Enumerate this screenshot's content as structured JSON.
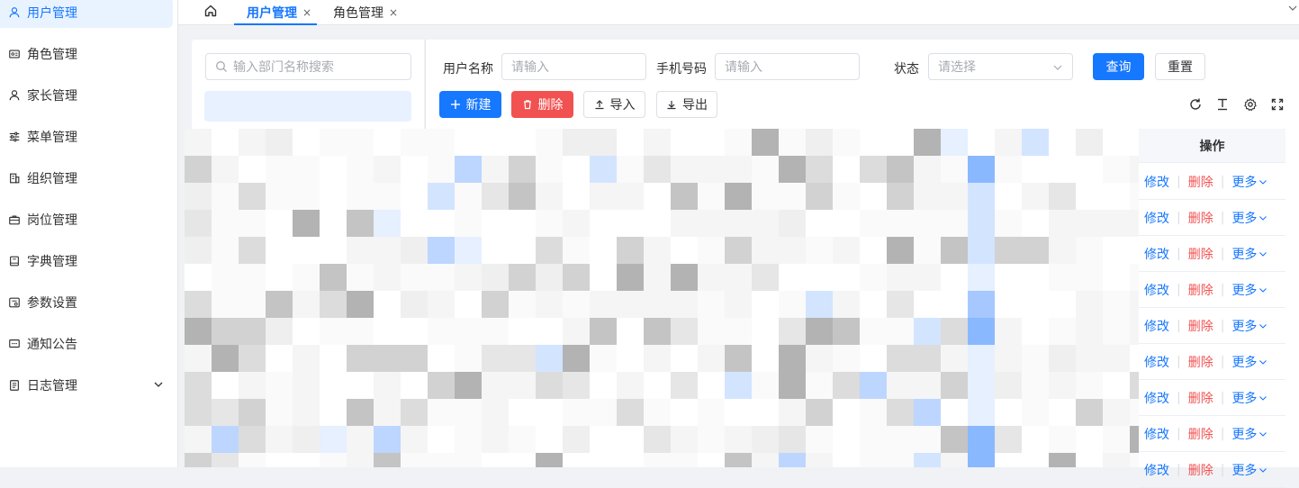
{
  "sidebar": {
    "items": [
      {
        "label": "用户管理",
        "icon": "user-icon",
        "active": true
      },
      {
        "label": "角色管理",
        "icon": "id-card-icon"
      },
      {
        "label": "家长管理",
        "icon": "user-icon"
      },
      {
        "label": "菜单管理",
        "icon": "sliders-icon"
      },
      {
        "label": "组织管理",
        "icon": "building-icon"
      },
      {
        "label": "岗位管理",
        "icon": "briefcase-icon"
      },
      {
        "label": "字典管理",
        "icon": "book-icon"
      },
      {
        "label": "参数设置",
        "icon": "settings-card-icon"
      },
      {
        "label": "通知公告",
        "icon": "message-icon"
      },
      {
        "label": "日志管理",
        "icon": "document-icon"
      }
    ]
  },
  "tabs": [
    {
      "label": "用户管理",
      "close": "×"
    },
    {
      "label": "角色管理",
      "close": "×"
    }
  ],
  "dept_search": {
    "placeholder": "输入部门名称搜索"
  },
  "filters": {
    "username_label": "用户名称",
    "username_placeholder": "请输入",
    "phone_label": "手机号码",
    "phone_placeholder": "请输入",
    "status_label": "状态",
    "status_placeholder": "请选择"
  },
  "buttons": {
    "query": "查询",
    "reset": "重置",
    "add": "新建",
    "delete": "删除",
    "import": "导入",
    "export": "导出"
  },
  "table": {
    "op_header": "操作",
    "row_actions": {
      "edit": "修改",
      "delete": "删除",
      "more": "更多",
      "sep": "|"
    }
  },
  "colors": {
    "primary": "#1677ff",
    "danger": "#f25151"
  }
}
